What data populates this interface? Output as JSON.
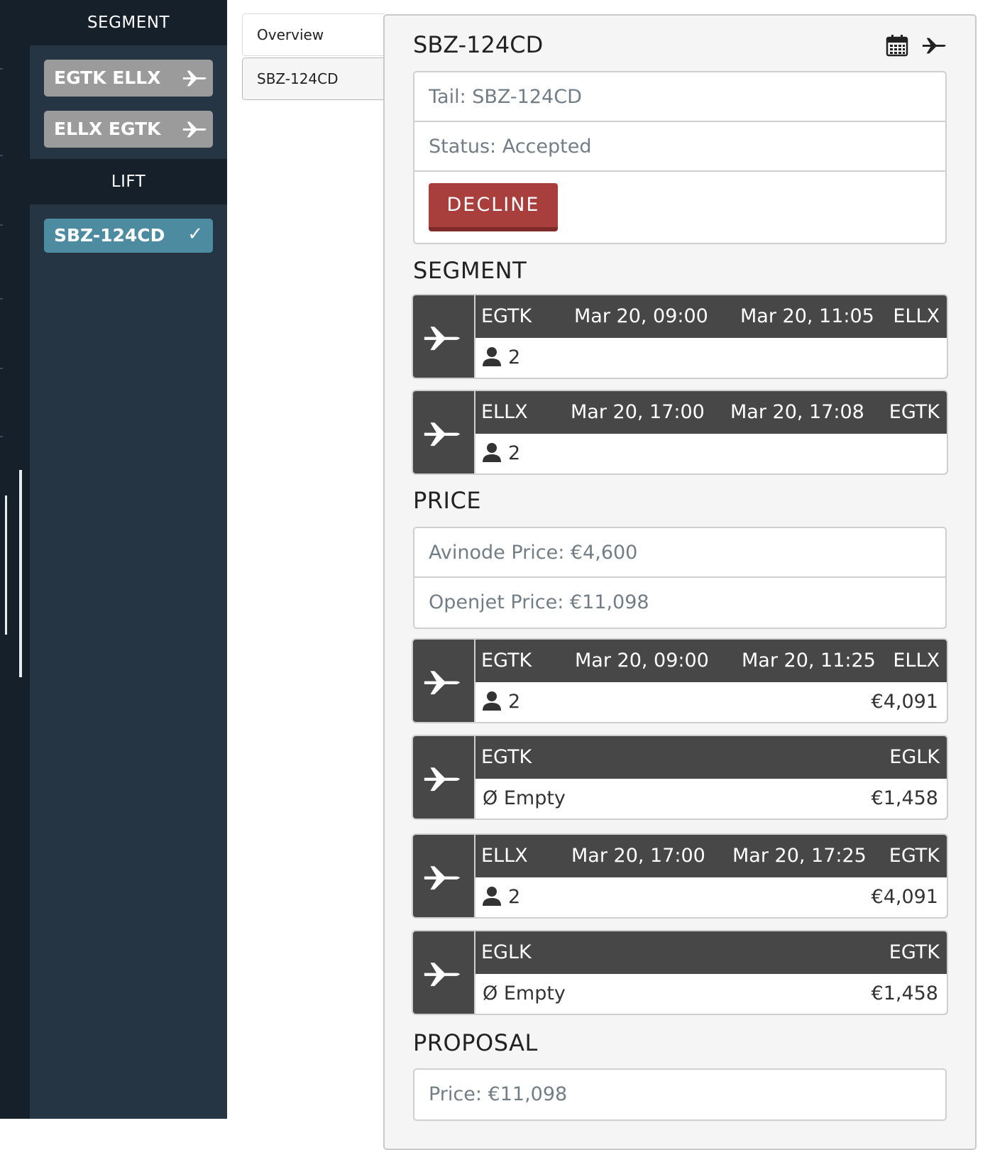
{
  "sidebar": {
    "segment_header": "SEGMENT",
    "segments": [
      {
        "label": "EGTK ELLX",
        "icon": "plane-icon"
      },
      {
        "label": "ELLX EGTK",
        "icon": "plane-icon"
      }
    ],
    "lift_header": "LIFT",
    "lifts": [
      {
        "label": "SBZ-124CD",
        "check": "✓"
      }
    ]
  },
  "tabs": [
    "Overview",
    "SBZ-124CD"
  ],
  "panel": {
    "title": "SBZ-124CD",
    "tail": "Tail: SBZ-124CD",
    "status": "Status: Accepted",
    "decline_label": "DECLINE"
  },
  "segment_section": {
    "title": "SEGMENT",
    "legs": [
      {
        "from": "EGTK",
        "dep": "Mar 20, 09:00",
        "arr": "Mar 20, 11:05",
        "to": "ELLX",
        "pax": "2"
      },
      {
        "from": "ELLX",
        "dep": "Mar 20, 17:00",
        "arr": "Mar 20, 17:08",
        "to": "EGTK",
        "pax": "2"
      }
    ]
  },
  "price_section": {
    "title": "PRICE",
    "avinode_price": "Avinode Price: €4,600",
    "openjet_price": "Openjet Price: €11,098",
    "legs": [
      {
        "from": "EGTK",
        "dep": "Mar 20, 09:00",
        "arr": "Mar 20, 11:25",
        "to": "ELLX",
        "pax": "2",
        "price": "€4,091"
      },
      {
        "from": "EGTK",
        "dep": "",
        "arr": "",
        "to": "EGLK",
        "pax": "Ø Empty",
        "price": "€1,458"
      },
      {
        "from": "ELLX",
        "dep": "Mar 20, 17:00",
        "arr": "Mar 20, 17:25",
        "to": "EGTK",
        "pax": "2",
        "price": "€4,091"
      },
      {
        "from": "EGLK",
        "dep": "",
        "arr": "",
        "to": "EGTK",
        "pax": "Ø Empty",
        "price": "€1,458"
      }
    ]
  },
  "proposal_section": {
    "title": "PROPOSAL",
    "price": "Price: €11,098"
  },
  "colors": {
    "sidebar_bg": "#263544",
    "sidebar_header_bg": "#16202b",
    "pill_inactive": "#9b9b9b",
    "pill_active": "#4d8ba1",
    "decline": "#a83f3d",
    "leg_bar": "#474747"
  }
}
